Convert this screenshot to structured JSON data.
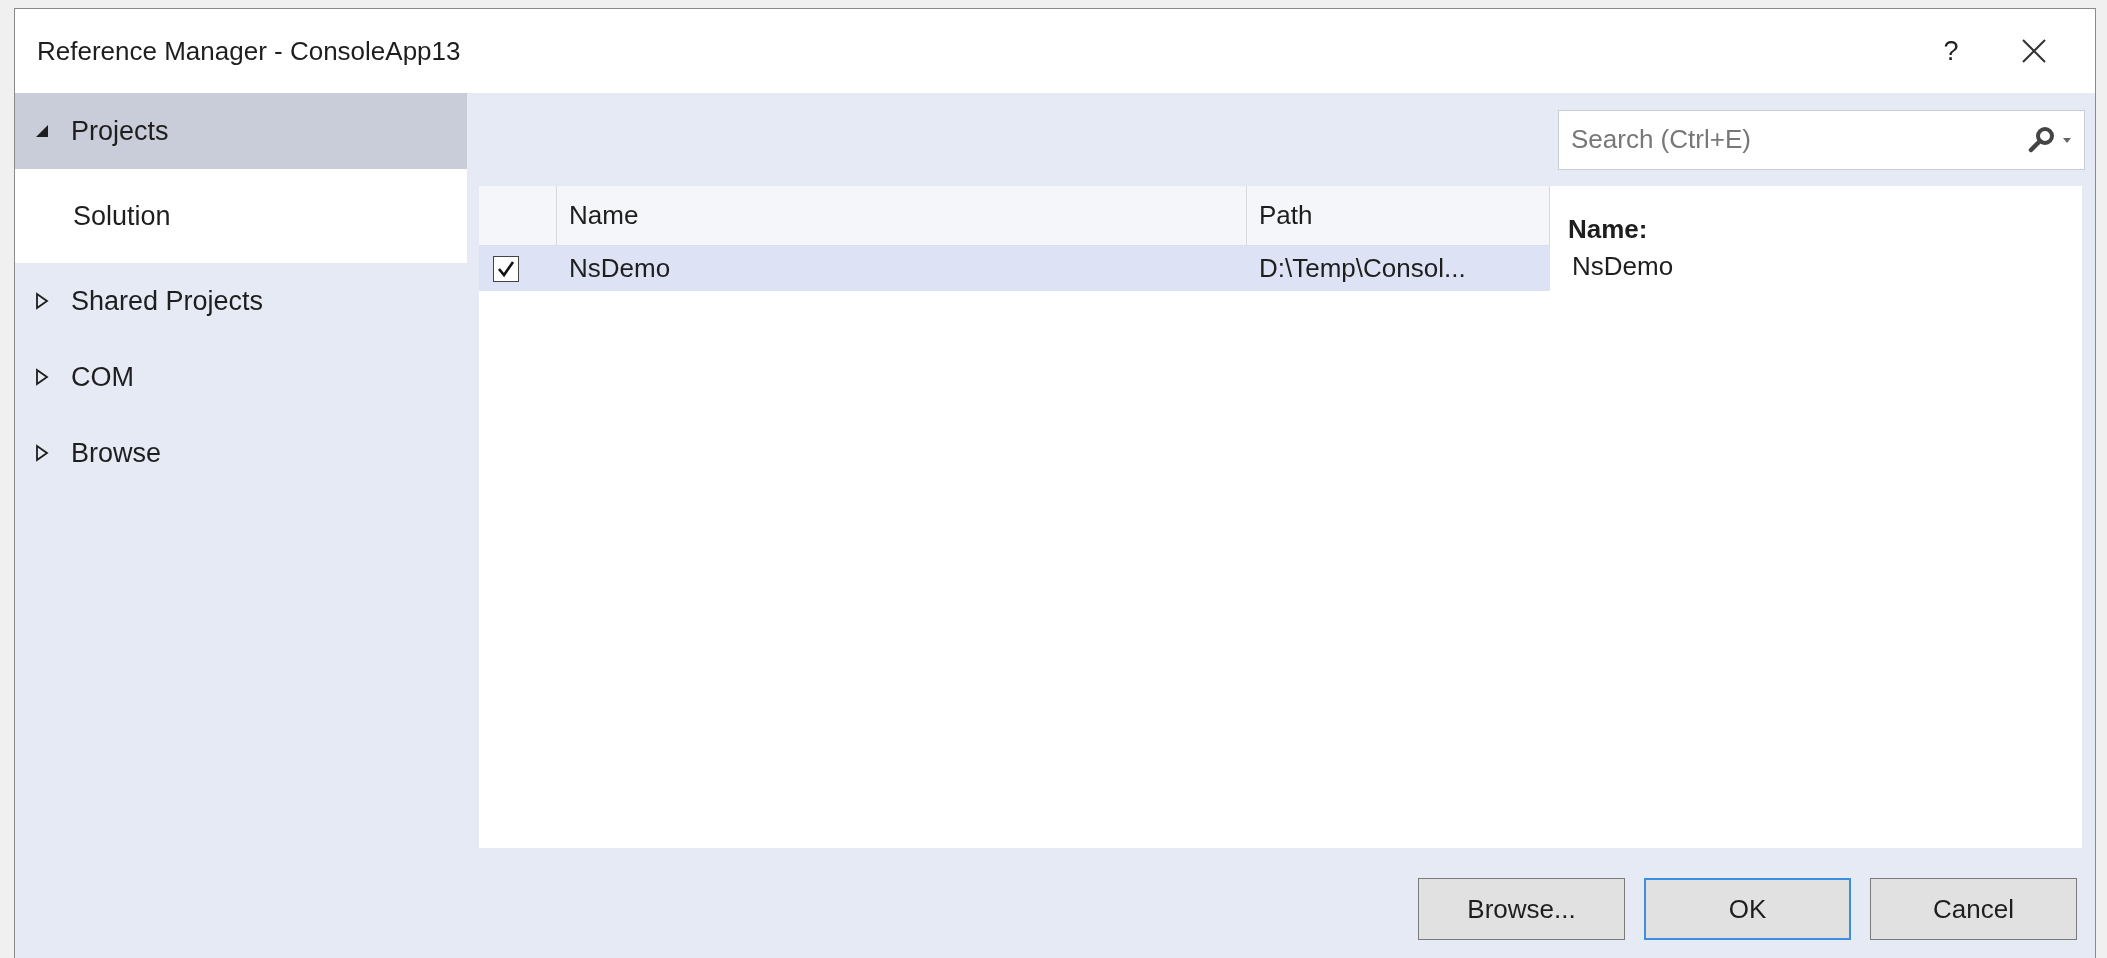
{
  "window": {
    "title": "Reference Manager - ConsoleApp13",
    "help": "?"
  },
  "sidebar": {
    "items": [
      {
        "label": "Projects",
        "expanded": true,
        "selected": false,
        "children": [
          {
            "label": "Solution",
            "selected": true
          }
        ]
      },
      {
        "label": "Shared Projects",
        "expanded": false,
        "selected": false
      },
      {
        "label": "COM",
        "expanded": false,
        "selected": false
      },
      {
        "label": "Browse",
        "expanded": false,
        "selected": false
      }
    ]
  },
  "search": {
    "placeholder": "Search (Ctrl+E)"
  },
  "table": {
    "columns": [
      "Name",
      "Path"
    ],
    "rows": [
      {
        "checked": true,
        "selected": true,
        "name": "NsDemo",
        "path": "D:\\Temp\\Consol..."
      }
    ]
  },
  "details": {
    "label": "Name:",
    "value": "NsDemo"
  },
  "buttons": [
    {
      "label": "Browse...",
      "focused": false
    },
    {
      "label": "OK",
      "focused": true
    },
    {
      "label": "Cancel",
      "focused": false
    }
  ]
}
